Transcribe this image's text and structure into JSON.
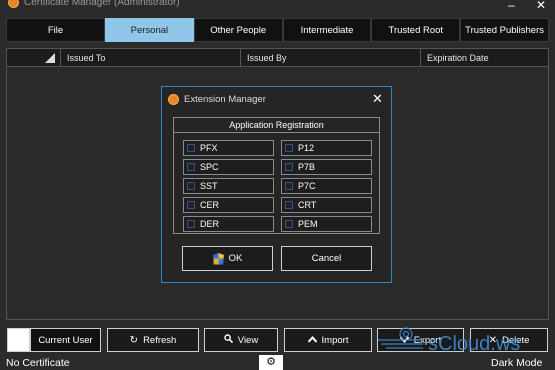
{
  "window": {
    "title": "Certificate Manager (Administrator)",
    "minimize": "–",
    "close": "✕"
  },
  "tabs": [
    {
      "label": "File"
    },
    {
      "label": "Personal",
      "active": true
    },
    {
      "label": "Other People"
    },
    {
      "label": "Intermediate"
    },
    {
      "label": "Trusted Root"
    },
    {
      "label": "Trusted Publishers"
    }
  ],
  "grid": {
    "columns": [
      "Issued To",
      "Issued By",
      "Expiration Date"
    ]
  },
  "dialog": {
    "title": "Extension Manager",
    "close": "✕",
    "group_title": "Application Registration",
    "extensions": [
      "PFX",
      "P12",
      "SPC",
      "P7B",
      "SST",
      "P7C",
      "CER",
      "CRT",
      "DER",
      "PEM"
    ],
    "ok_label": "OK",
    "cancel_label": "Cancel"
  },
  "toolbar": {
    "current_user": "Current User",
    "refresh": "Refresh",
    "view": "View",
    "import": "Import",
    "export": "Export",
    "delete": "Delete"
  },
  "status": {
    "left": "No Certificate",
    "right": "Dark Mode"
  },
  "watermark": {
    "text": "sCloud.ws"
  },
  "colors": {
    "accent": "#8fc6ea",
    "dialog_border": "#2f86c7",
    "background": "#2b2b2b"
  },
  "icons": {
    "app": "certificate-icon",
    "gear": "gear-icon",
    "shield": "uac-shield-icon"
  }
}
